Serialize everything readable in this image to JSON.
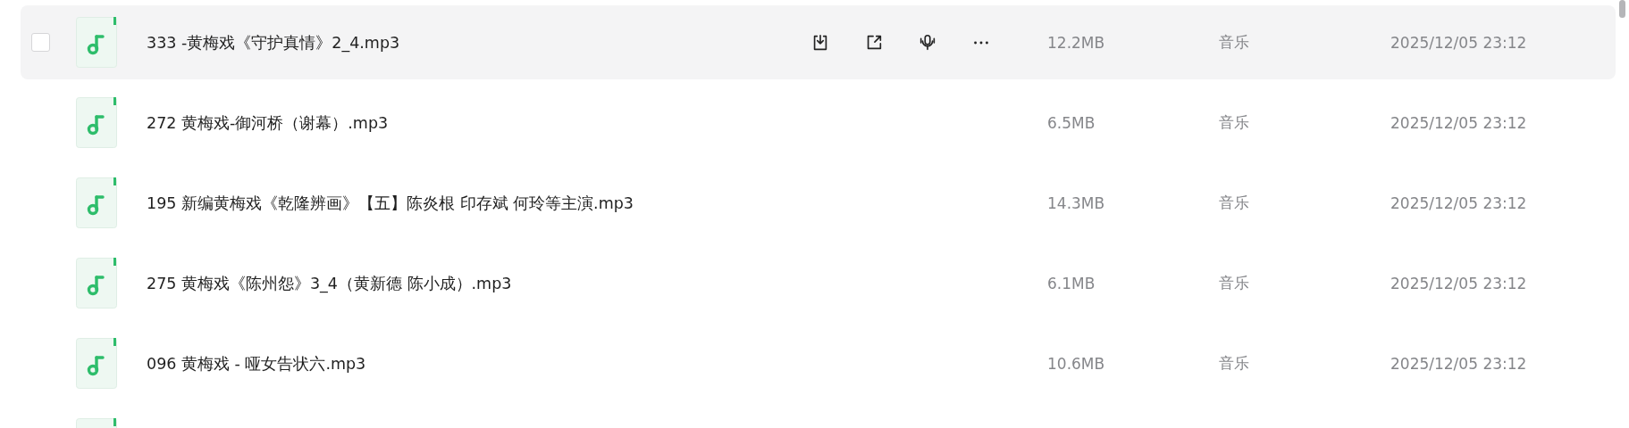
{
  "files": [
    {
      "kind": "audio",
      "name": "333 -黄梅戏《守护真情》2_4.mp3",
      "size": "12.2MB",
      "type": "音乐",
      "date": "2025/12/05 23:12",
      "hovered": true,
      "checked": false
    },
    {
      "kind": "audio",
      "name": "272 黄梅戏-御河桥（谢幕）.mp3",
      "size": "6.5MB",
      "type": "音乐",
      "date": "2025/12/05 23:12",
      "hovered": false
    },
    {
      "kind": "audio",
      "name": "195 新编黄梅戏《乾隆辨画》【五】陈炎根 印存斌 何玲等主演.mp3",
      "size": "14.3MB",
      "type": "音乐",
      "date": "2025/12/05 23:12",
      "hovered": false
    },
    {
      "kind": "audio",
      "name": "275 黄梅戏《陈州怨》3_4（黄新德 陈小成）.mp3",
      "size": "6.1MB",
      "type": "音乐",
      "date": "2025/12/05 23:12",
      "hovered": false
    },
    {
      "kind": "audio",
      "name": "096 黄梅戏 - 哑女告状六.mp3",
      "size": "10.6MB",
      "type": "音乐",
      "date": "2025/12/05 23:12",
      "hovered": false
    },
    {
      "kind": "audio"
    }
  ]
}
